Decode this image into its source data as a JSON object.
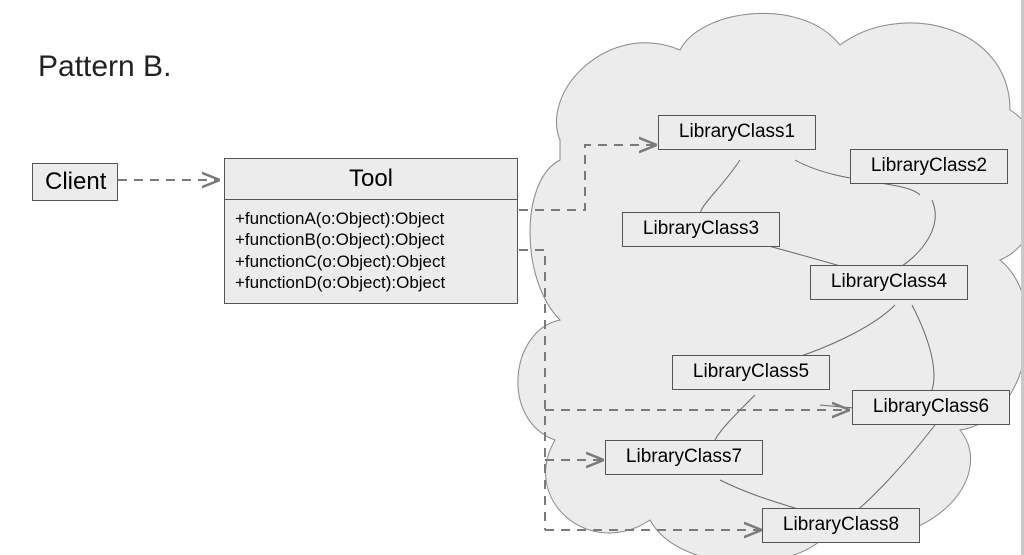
{
  "title": "Pattern B.",
  "client": {
    "label": "Client"
  },
  "tool": {
    "name": "Tool",
    "methods": [
      "+functionA(o:Object):Object",
      "+functionB(o:Object):Object",
      "+functionC(o:Object):Object",
      "+functionD(o:Object):Object"
    ]
  },
  "library": {
    "c1": "LibraryClass1",
    "c2": "LibraryClass2",
    "c3": "LibraryClass3",
    "c4": "LibraryClass4",
    "c5": "LibraryClass5",
    "c6": "LibraryClass6",
    "c7": "LibraryClass7",
    "c8": "LibraryClass8"
  },
  "arrows": {
    "client_to_tool": {
      "kind": "dashed-dependency"
    },
    "tool_to_lib1": {
      "kind": "dashed-dependency"
    },
    "tool_to_lib6": {
      "kind": "dashed-dependency"
    },
    "tool_to_lib7": {
      "kind": "dashed-dependency"
    },
    "tool_to_lib8": {
      "kind": "dashed-dependency"
    }
  },
  "colors": {
    "box_fill": "#ececec",
    "box_stroke": "#555555",
    "dashed": "#7a7a7a",
    "cloud_stroke": "#888888",
    "text": "#222222"
  }
}
